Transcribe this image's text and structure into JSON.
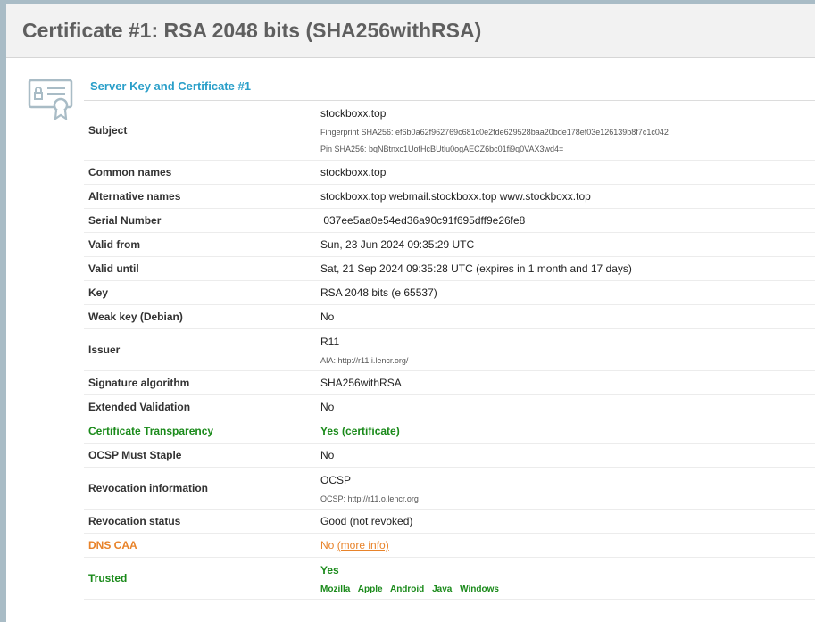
{
  "header": {
    "title": "Certificate #1: RSA 2048 bits (SHA256withRSA)"
  },
  "section": {
    "title": "Server Key and Certificate #1"
  },
  "rows": {
    "subject": {
      "label": "Subject",
      "value": "stockboxx.top",
      "fingerprint": "Fingerprint SHA256: ef6b0a62f962769c681c0e2fde629528baa20bde178ef03e126139b8f7c1c042",
      "pin": "Pin SHA256: bqNBtnxc1UofHcBUtlu0ogAECZ6bc01fi9q0VAX3wd4="
    },
    "common_names": {
      "label": "Common names",
      "value": "stockboxx.top"
    },
    "alt_names": {
      "label": "Alternative names",
      "value": "stockboxx.top webmail.stockboxx.top www.stockboxx.top"
    },
    "serial": {
      "label": "Serial Number",
      "value": " 037ee5aa0e54ed36a90c91f695dff9e26fe8"
    },
    "valid_from": {
      "label": "Valid from",
      "value": "Sun, 23 Jun 2024 09:35:29 UTC"
    },
    "valid_until": {
      "label": "Valid until",
      "value": "Sat, 21 Sep 2024 09:35:28 UTC (expires in 1 month and 17 days)"
    },
    "key": {
      "label": "Key",
      "value": "RSA 2048 bits (e 65537)"
    },
    "weak_key": {
      "label": "Weak key (Debian)",
      "value": "No"
    },
    "issuer": {
      "label": "Issuer",
      "value": "R11",
      "aia": "AIA: http://r11.i.lencr.org/"
    },
    "sig_alg": {
      "label": "Signature algorithm",
      "value": "SHA256withRSA"
    },
    "ev": {
      "label": "Extended Validation",
      "value": "No"
    },
    "ct": {
      "label": "Certificate Transparency",
      "value": "Yes (certificate)"
    },
    "ocsp_staple": {
      "label": "OCSP Must Staple",
      "value": "No"
    },
    "revocation_info": {
      "label": "Revocation information",
      "value": "OCSP",
      "ocsp": "OCSP: http://r11.o.lencr.org"
    },
    "revocation_status": {
      "label": "Revocation status",
      "value": "Good (not revoked)"
    },
    "dns_caa": {
      "label": "DNS CAA",
      "value": "No",
      "link": "(more info)"
    },
    "trusted": {
      "label": "Trusted",
      "value": "Yes",
      "clients": [
        "Mozilla",
        "Apple",
        "Android",
        "Java",
        "Windows"
      ]
    }
  },
  "colors": {
    "accent": "#2a9fc9",
    "good": "#1a8a1a",
    "warn": "#e8832a",
    "frame": "#a9bcc6"
  },
  "icons": {
    "certificate": "certificate-icon"
  }
}
